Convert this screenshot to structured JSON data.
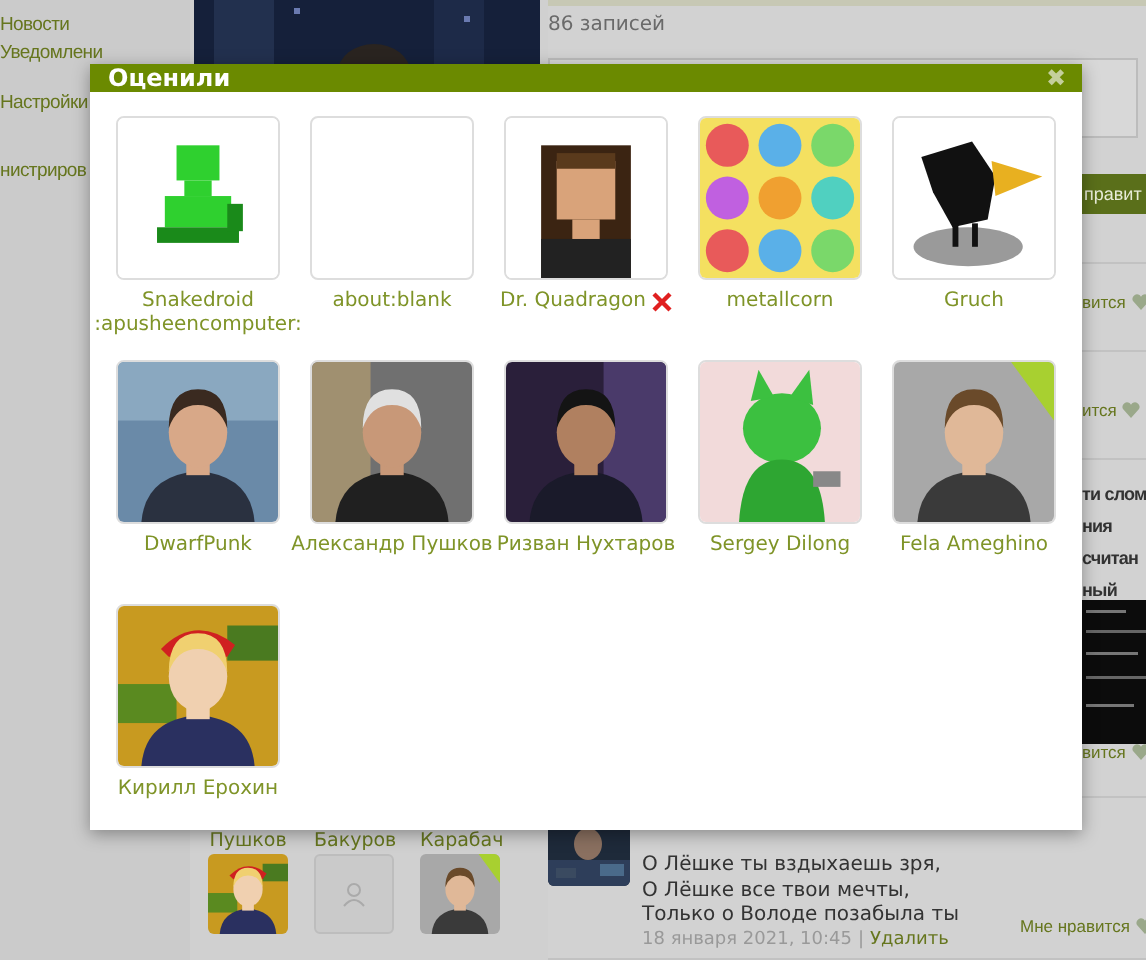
{
  "sidebar": {
    "items": [
      {
        "label": "Новости"
      },
      {
        "label": "Уведомлени"
      },
      {
        "label": "Настройки"
      },
      {
        "label": "нистриров"
      }
    ]
  },
  "feed": {
    "count": "86 записей",
    "send_button": "правит",
    "like_links": [
      "вится",
      "ится",
      "вится"
    ],
    "post_fragment": [
      "ти слом",
      "ния",
      "считан",
      "ный"
    ],
    "friends": [
      "Пушков",
      "Бакуров",
      "Карабач"
    ],
    "friend_avatars": [
      {
        "kind": "picture"
      },
      {
        "kind": "blank"
      },
      {
        "kind": "picture"
      }
    ],
    "post": {
      "lines": [
        "О Лёшке ты вздыхаешь зря,",
        "О Лёшке все твои мечты,",
        "Только о Володе позабыла ты"
      ],
      "date": "18 января 2021, 10:45",
      "separator": "|",
      "delete": "Удалить",
      "like": "Мне нравится"
    }
  },
  "modal": {
    "title": "Оценили",
    "close": "✖",
    "users": [
      {
        "name": "Snakedroid :apusheencomputer:",
        "kind": "picture",
        "banned": false
      },
      {
        "name": "about:blank",
        "kind": "blank",
        "banned": false
      },
      {
        "name": "Dr. Quadragon",
        "kind": "picture",
        "banned": true
      },
      {
        "name": "metallcorn",
        "kind": "picture",
        "banned": false
      },
      {
        "name": "Gruch",
        "kind": "picture",
        "banned": false
      },
      {
        "name": "DwarfPunk",
        "kind": "picture",
        "banned": false
      },
      {
        "name": "Александр Пушков",
        "kind": "picture",
        "banned": false
      },
      {
        "name": "Ризван Нухтаров",
        "kind": "picture",
        "banned": false
      },
      {
        "name": "Sergey Dilong",
        "kind": "picture",
        "banned": false
      },
      {
        "name": "Fela Ameghino",
        "kind": "picture",
        "banned": false
      },
      {
        "name": "Кирилл Ерохин",
        "kind": "picture",
        "banned": false
      }
    ]
  }
}
